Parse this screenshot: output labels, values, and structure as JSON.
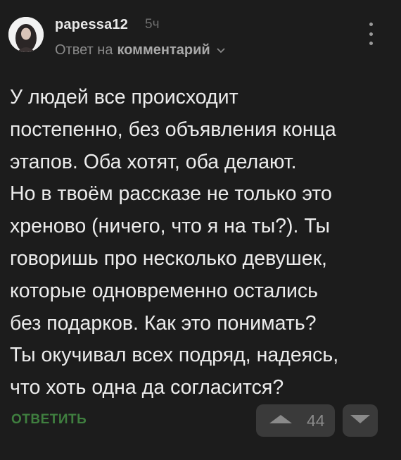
{
  "comment": {
    "author": "papessa12",
    "time": "5ч",
    "reply_prefix": "Ответ на",
    "reply_target": "комментарий",
    "text_lines": [
      "У людей все происходит",
      "постепенно, без объявления конца",
      "этапов. Оба хотят, оба делают.",
      "Но в твоём рассказе не только это",
      "хреново (ничего, что я на ты?). Ты",
      "говоришь про несколько девушек,",
      "которые одновременно остались",
      "без подарков. Как это понимать?",
      "Ты окучивал всех подряд, надеясь,",
      "что хоть одна да согласится?"
    ],
    "reply_button": "ОТВЕТИТЬ",
    "rating": "44"
  },
  "icons": {
    "more": "more-vertical-icon",
    "chevron": "chevron-down-icon",
    "upvote": "triangle-up-icon",
    "downvote": "triangle-down-icon"
  },
  "colors": {
    "background": "#1c1c1c",
    "text": "#ececec",
    "muted": "#8a8a8a",
    "reply_green": "#3f7f3f",
    "button_bg": "#3a3a3a"
  }
}
